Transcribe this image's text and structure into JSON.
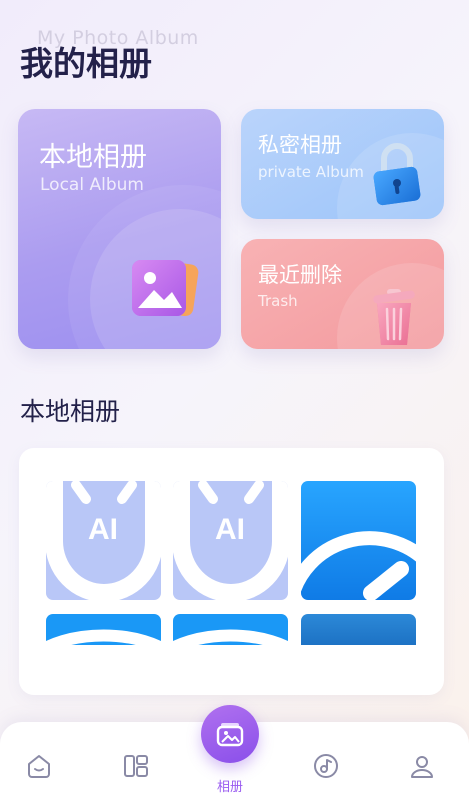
{
  "header": {
    "subtitle_en": "My Photo Album",
    "title": "我的相册"
  },
  "cards": {
    "local": {
      "title": "本地相册",
      "subtitle": "Local Album"
    },
    "private": {
      "title": "私密相册",
      "subtitle": "private Album"
    },
    "trash": {
      "title": "最近删除",
      "subtitle": "Trash"
    }
  },
  "section": {
    "title": "本地相册"
  },
  "thumbnails": [
    {
      "name": "ai-shield-image",
      "label": "AI"
    },
    {
      "name": "ai-shield-image",
      "label": "AI"
    },
    {
      "name": "blue-gauge-image"
    },
    {
      "name": "blue-arc-image"
    },
    {
      "name": "blue-arc-image"
    },
    {
      "name": "blue-gradient-image"
    }
  ],
  "bottom_nav": {
    "items": [
      {
        "icon": "home-smile-icon"
      },
      {
        "icon": "layout-grid-icon"
      },
      {
        "icon": "album-icon",
        "label": "相册",
        "active": true
      },
      {
        "icon": "music-disc-icon"
      },
      {
        "icon": "profile-icon"
      }
    ]
  },
  "colors": {
    "accent": "#9a5cf0",
    "title_text": "#23214a",
    "local_card": "#ab9cf0",
    "private_card": "#9cc4fa",
    "trash_card": "#f39a9e"
  }
}
